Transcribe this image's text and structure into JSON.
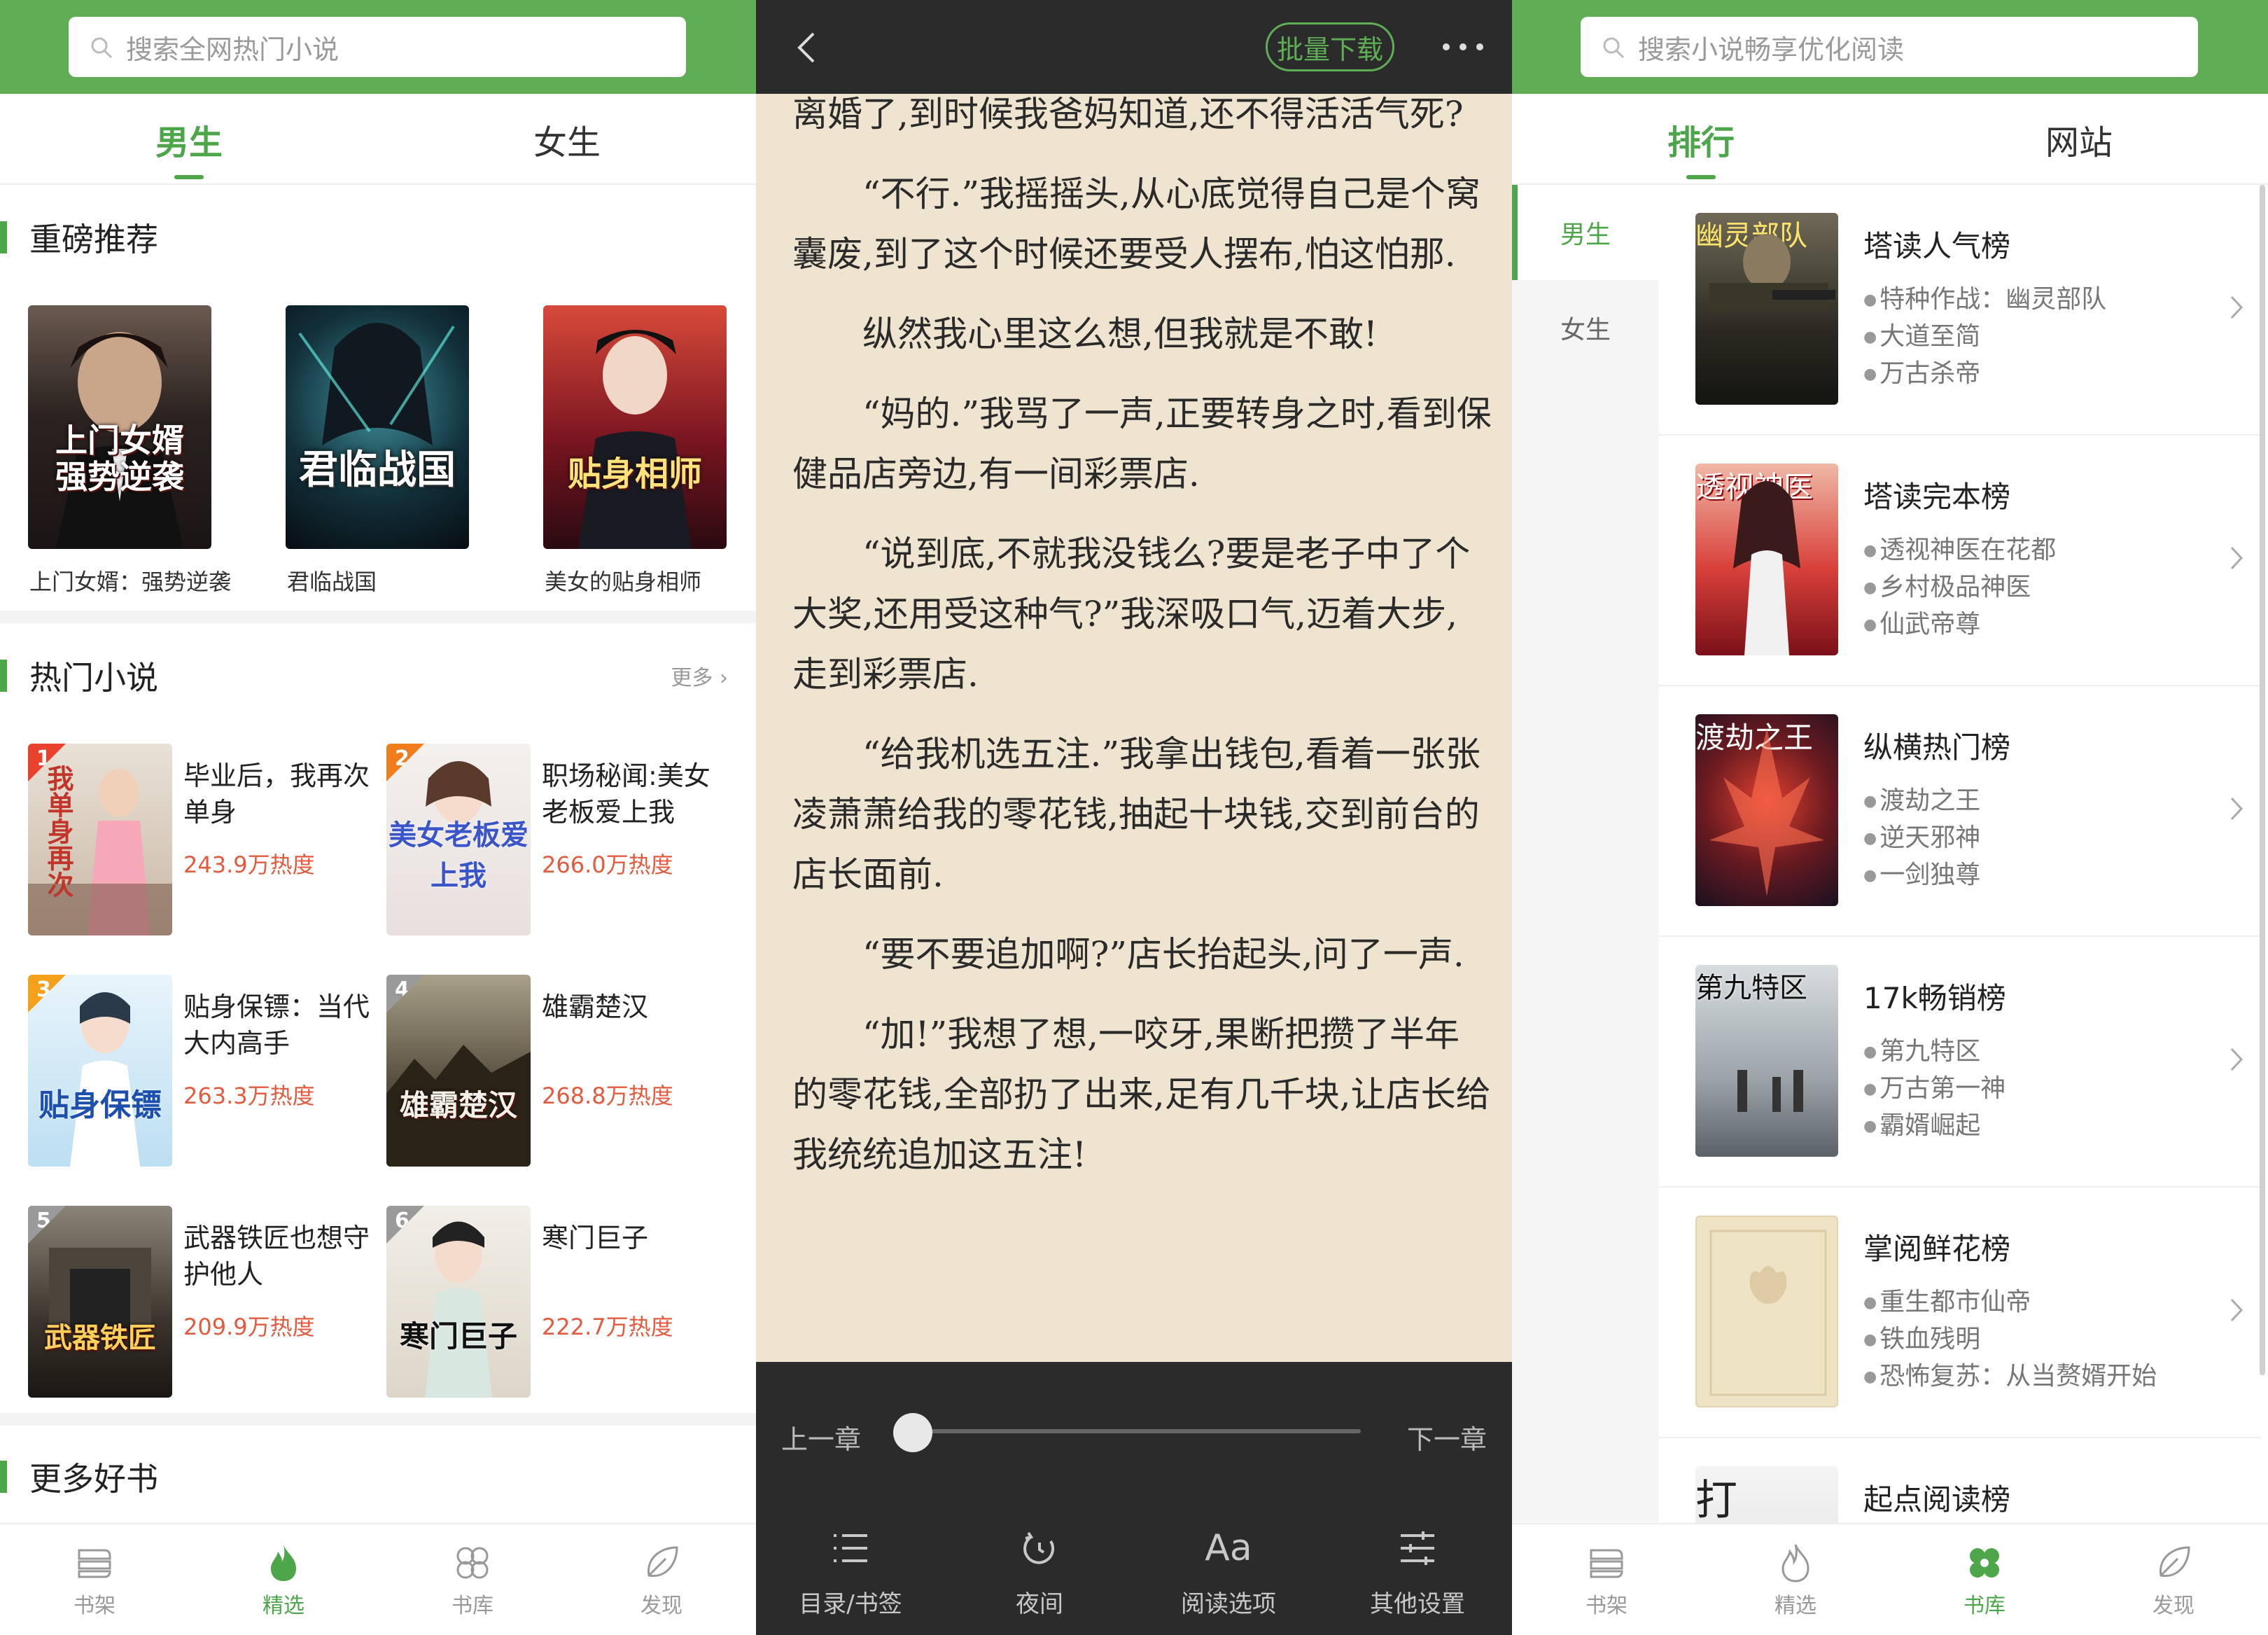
{
  "colors": {
    "brand": "#5fae56",
    "accent": "#4ea64a",
    "heat": "#e25b3e",
    "reader_bg": "#efe4cf",
    "reader_bar": "#2b2b2b"
  },
  "panel1": {
    "search_placeholder": "搜索全网热门小说",
    "tabs": [
      "男生",
      "女生"
    ],
    "featured": {
      "title": "重磅推荐",
      "books": [
        {
          "name": "上门女婿：强势逆袭",
          "cover_text": "上门女婿\n强势逆袭"
        },
        {
          "name": "君临战国",
          "cover_text": "君临战国"
        },
        {
          "name": "美女的贴身相师",
          "cover_text": "贴身相师"
        }
      ]
    },
    "hot": {
      "title": "热门小说",
      "more": "更多",
      "books": [
        {
          "rank": "1",
          "title": "毕业后，我再次单身",
          "heat": "243.9万热度",
          "cover_text": "我单身再次"
        },
        {
          "rank": "2",
          "title": "职场秘闻:美女老板爱上我",
          "heat": "266.0万热度",
          "cover_text": "美女老板爱上我"
        },
        {
          "rank": "3",
          "title": "贴身保镖：当代大内高手",
          "heat": "263.3万热度",
          "cover_text": "贴身保镖"
        },
        {
          "rank": "4",
          "title": "雄霸楚汉",
          "heat": "268.8万热度",
          "cover_text": "雄霸楚汉"
        },
        {
          "rank": "5",
          "title": "武器铁匠也想守护他人",
          "heat": "209.9万热度",
          "cover_text": "武器铁匠"
        },
        {
          "rank": "6",
          "title": "寒门巨子",
          "heat": "222.7万热度",
          "cover_text": "寒门巨子"
        }
      ]
    },
    "more_books_title": "更多好书",
    "nav": [
      {
        "label": "书架",
        "icon": "bookshelf-icon"
      },
      {
        "label": "精选",
        "icon": "flame-icon"
      },
      {
        "label": "书库",
        "icon": "library-icon"
      },
      {
        "label": "发现",
        "icon": "leaf-icon"
      }
    ],
    "nav_active": 1
  },
  "panel2": {
    "download_label": "批量下载",
    "paragraphs": [
      {
        "text": "离婚了,到时候我爸妈知道,还不得活活气死?",
        "indent": false
      },
      {
        "text": "“不行.”我摇摇头,从心底觉得自己是个窝囊废,到了这个时候还要受人摆布,怕这怕那.",
        "indent": true
      },
      {
        "text": "纵然我心里这么想,但我就是不敢!",
        "indent": true
      },
      {
        "text": "“妈的.”我骂了一声,正要转身之时,看到保健品店旁边,有一间彩票店.",
        "indent": true
      },
      {
        "text": "“说到底,不就我没钱么?要是老子中了个大奖,还用受这种气?”我深吸口气,迈着大步,走到彩票店.",
        "indent": true
      },
      {
        "text": "“给我机选五注.”我拿出钱包,看着一张张凌萧萧给我的零花钱,抽起十块钱,交到前台的店长面前.",
        "indent": true
      },
      {
        "text": "“要不要追加啊?”店长抬起头,问了一声.",
        "indent": true
      },
      {
        "text": "“加!”我想了想,一咬牙,果断把攒了半年的零花钱,全部扔了出来,足有几千块,让店长给我统统追加这五注!",
        "indent": true
      }
    ],
    "prev_chapter": "上一章",
    "next_chapter": "下一章",
    "progress": 0.0,
    "tools": [
      {
        "label": "目录/书签",
        "icon": "list-icon"
      },
      {
        "label": "夜间",
        "icon": "night-mode-icon"
      },
      {
        "label": "阅读选项",
        "icon": "font-icon"
      },
      {
        "label": "其他设置",
        "icon": "settings-sliders-icon"
      }
    ],
    "font_glyph": "Aa"
  },
  "panel3": {
    "search_placeholder": "搜索小说畅享优化阅读",
    "tabs": [
      "排行",
      "网站"
    ],
    "sidebar": [
      "男生",
      "女生"
    ],
    "ranks": [
      {
        "title": "塔读人气榜",
        "books": [
          "特种作战：幽灵部队",
          "大道至简",
          "万古杀帝"
        ],
        "cover_text": "幽灵部队"
      },
      {
        "title": "塔读完本榜",
        "books": [
          "透视神医在花都",
          "乡村极品神医",
          "仙武帝尊"
        ],
        "cover_text": "透视神医"
      },
      {
        "title": "纵横热门榜",
        "books": [
          "渡劫之王",
          "逆天邪神",
          "一剑独尊"
        ],
        "cover_text": "渡劫之王"
      },
      {
        "title": "17k畅销榜",
        "books": [
          "第九特区",
          "万古第一神",
          "霸婿崛起"
        ],
        "cover_text": "第九特区"
      },
      {
        "title": "掌阅鲜花榜",
        "books": [
          "重生都市仙帝",
          "铁血残明",
          "恐怖复苏：从当赘婿开始"
        ],
        "cover_text": ""
      },
      {
        "title": "起点阅读榜",
        "books": [],
        "cover_text": "打"
      }
    ],
    "nav": [
      {
        "label": "书架",
        "icon": "bookshelf-icon"
      },
      {
        "label": "精选",
        "icon": "flame-icon"
      },
      {
        "label": "书库",
        "icon": "library-icon"
      },
      {
        "label": "发现",
        "icon": "leaf-icon"
      }
    ],
    "nav_active": 2
  }
}
